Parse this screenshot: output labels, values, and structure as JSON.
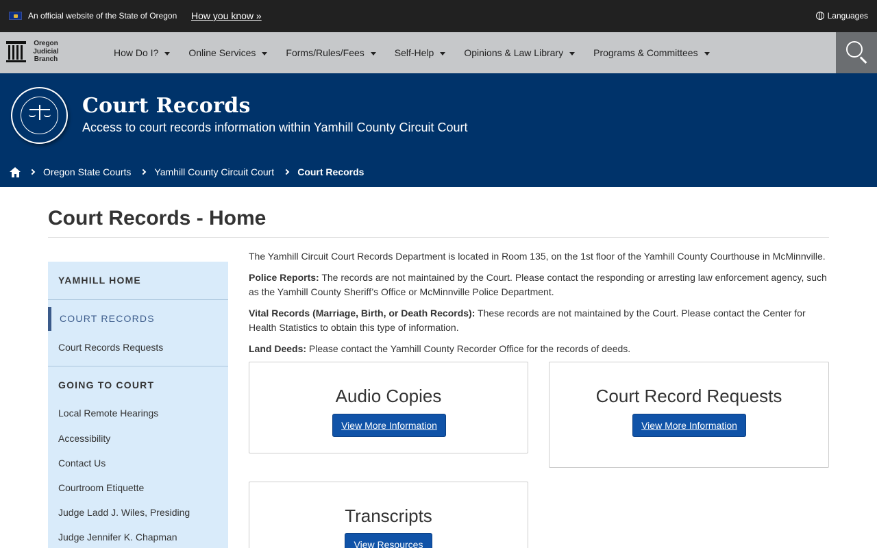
{
  "official_banner": {
    "text": "An official website of the State of Oregon",
    "how_link": "How you know »",
    "languages": "Languages"
  },
  "header": {
    "logo_lines": [
      "Oregon",
      "Judicial",
      "Branch"
    ],
    "nav": [
      {
        "label": "How Do I?"
      },
      {
        "label": "Online Services"
      },
      {
        "label": "Forms/Rules/Fees"
      },
      {
        "label": "Self-Help"
      },
      {
        "label": "Opinions & Law Library"
      },
      {
        "label": "Programs & Committees"
      }
    ]
  },
  "hero": {
    "title": "Court Records",
    "subtitle": "Access to court records information within Yamhill County Circuit Court",
    "breadcrumb": [
      "Oregon State Courts",
      "Yamhill County Circuit Court",
      "Court Records"
    ]
  },
  "page": {
    "title": "Court Records - Home"
  },
  "sidebar": {
    "home": "YAMHILL HOME",
    "court_records": "COURT RECORDS",
    "court_records_requests": "Court Records Requests",
    "going_to_court": "GOING TO COURT",
    "links": [
      "Local Remote Hearings",
      "Accessibility",
      "Contact Us",
      "Courtroom Etiquette",
      "Judge Ladd J. Wiles, Presiding",
      "Judge Jennifer K. Chapman"
    ]
  },
  "content": {
    "intro": "The Yamhill Circuit Court Records Department is located in Room 135, on the 1st floor of the Yamhill County Courthouse in McMinnville.",
    "police_label": "Police Reports:",
    "police_text": " The records are not maintained by the Court. Please contact the responding or arresting law enforcement agency, such as the Yamhill County Sheriff’s Office or McMinnville Police Department.",
    "vital_label": "Vital Records (Marriage, Birth, or Death Records):",
    "vital_text": " These records are not maintained by the Court. Please contact the Center for Health Statistics to obtain this type of information.",
    "land_label": "Land Deeds:",
    "land_text": " Please contact the Yamhill County Recorder Office for the records of deeds."
  },
  "cards": {
    "audio": {
      "title": "Audio Copies",
      "button": "View More Information"
    },
    "requests": {
      "title": "Court Record Requests",
      "button": "View More Information"
    },
    "transcripts": {
      "title": "Transcripts",
      "button": "View Resources"
    }
  }
}
